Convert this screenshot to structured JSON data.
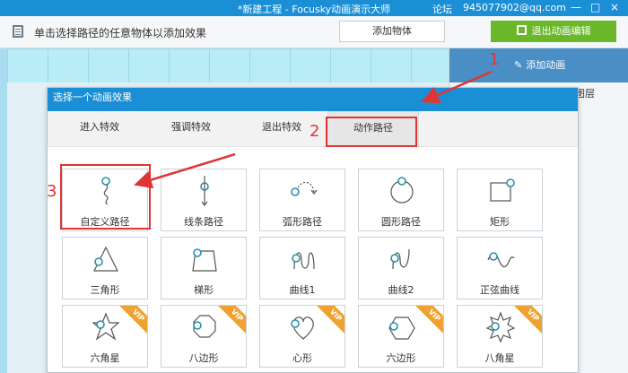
{
  "titlebar": {
    "title": "*新建工程 - Focusky动画演示大师",
    "forum": "论坛",
    "email": "945077902@qq.com",
    "minimize": "—",
    "maximize": "□",
    "close": "×"
  },
  "toolbar": {
    "hint": "单击选择路径的任意物体以添加效果",
    "add_object": "添加物体",
    "exit_anim_edit": "退出动画编辑"
  },
  "right_panel": {
    "add_animation": "添加动画",
    "layer_label": "图层"
  },
  "dialog": {
    "title": "选择一个动画效果",
    "tabs": [
      "进入特效",
      "强调特效",
      "退出特效",
      "动作路径"
    ],
    "active_tab": "动作路径",
    "items": [
      {
        "label": "自定义路径",
        "icon": "custom-path-icon",
        "vip": false
      },
      {
        "label": "线条路径",
        "icon": "line-path-icon",
        "vip": false
      },
      {
        "label": "弧形路径",
        "icon": "arc-path-icon",
        "vip": false
      },
      {
        "label": "圆形路径",
        "icon": "circle-path-icon",
        "vip": false
      },
      {
        "label": "矩形",
        "icon": "rectangle-path-icon",
        "vip": false
      },
      {
        "label": "三角形",
        "icon": "triangle-path-icon",
        "vip": false
      },
      {
        "label": "梯形",
        "icon": "trapezoid-path-icon",
        "vip": false
      },
      {
        "label": "曲线1",
        "icon": "curve1-path-icon",
        "vip": false
      },
      {
        "label": "曲线2",
        "icon": "curve2-path-icon",
        "vip": false
      },
      {
        "label": "正弦曲线",
        "icon": "sine-path-icon",
        "vip": false
      },
      {
        "label": "六角星",
        "icon": "hexagram-path-icon",
        "vip": true
      },
      {
        "label": "八边形",
        "icon": "octagon-path-icon",
        "vip": true
      },
      {
        "label": "心形",
        "icon": "heart-path-icon",
        "vip": true
      },
      {
        "label": "六边形",
        "icon": "hexagon-path-icon",
        "vip": true
      },
      {
        "label": "八角星",
        "icon": "octagram-path-icon",
        "vip": true
      }
    ],
    "vip_badge": "VIP"
  },
  "annotations": {
    "step1": "1",
    "step2": "2",
    "step3": "3"
  },
  "colors": {
    "titlebar": "#1b8fd6",
    "exit_button": "#6ab82a",
    "add_anim_header": "#4a8ec6",
    "vip_badge": "#f0a231",
    "annotation_red": "#e03535",
    "icon_teal": "#2a8fa6"
  }
}
